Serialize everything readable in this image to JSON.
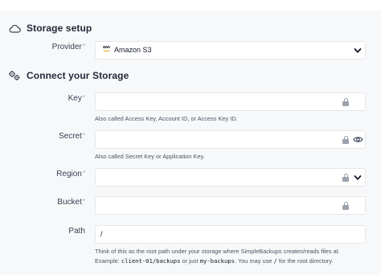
{
  "storage_setup": {
    "title": "Storage setup",
    "icon": "cloud-icon",
    "provider": {
      "label": "Provider",
      "required_mark": "*",
      "value": "Amazon S3",
      "logo_text": "aws"
    }
  },
  "connect_storage": {
    "title": "Connect your Storage",
    "icon": "gears-icon",
    "key": {
      "label": "Key",
      "required_mark": "*",
      "value": "",
      "hint": "Also called Access Key, Account ID, or Access Key ID."
    },
    "secret": {
      "label": "Secret",
      "required_mark": "*",
      "value": "",
      "hint": "Also called Secret Key or Application Key."
    },
    "region": {
      "label": "Region",
      "required_mark": "*",
      "value": ""
    },
    "bucket": {
      "label": "Bucket",
      "required_mark": "*",
      "value": ""
    },
    "path": {
      "label": "Path",
      "value": "/",
      "hint_line1": "Think of this as the root path under your storage where SimpleBackups creates/reads files at.",
      "hint_line2": {
        "prefix": "Example: ",
        "example1": "client-01/backups",
        "middle": " or just ",
        "example2": "my-backups",
        "middle2": ". You may use ",
        "example3": "/",
        "suffix": " for the root directory."
      }
    }
  },
  "colors": {
    "panel_bg": "#f7f8fa",
    "field_border": "#e5e7eb",
    "muted_icon": "#9ca3af",
    "aws_accent": "#f59e0b"
  }
}
